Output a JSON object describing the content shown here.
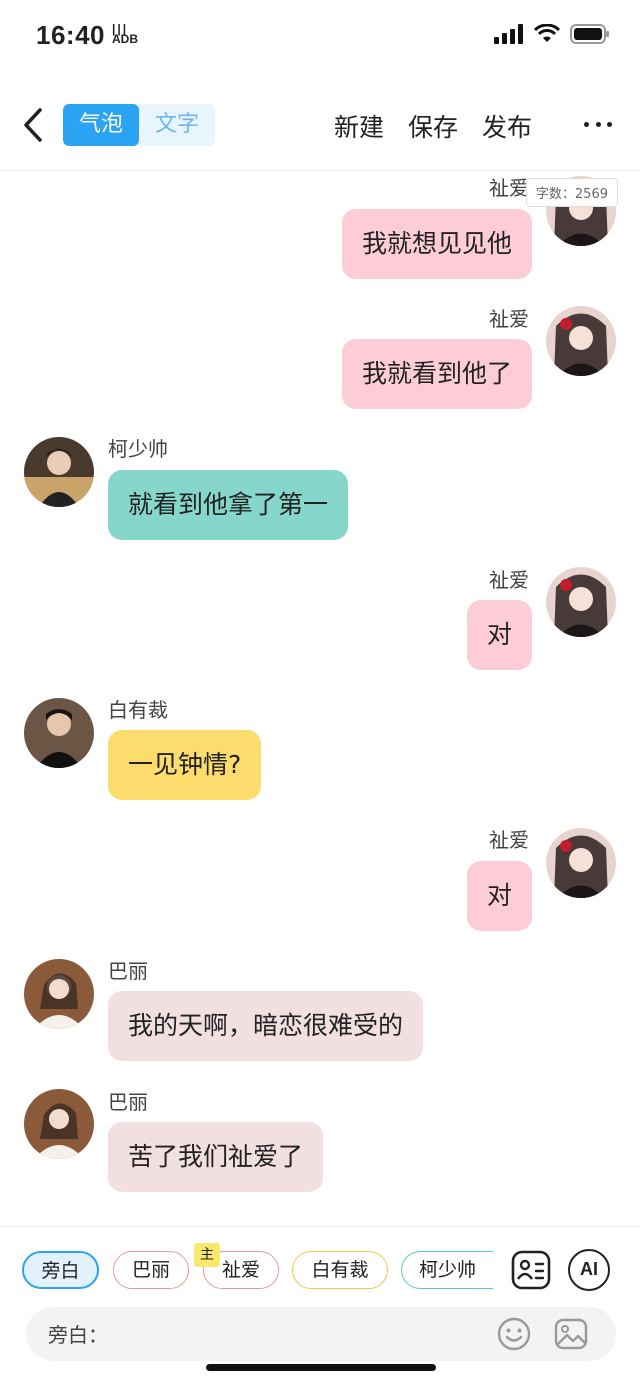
{
  "status": {
    "time": "16:40",
    "extra": "ADB"
  },
  "toolbar": {
    "seg_bubble": "气泡",
    "seg_text": "文字",
    "new_label": "新建",
    "save_label": "保存",
    "publish_label": "发布"
  },
  "word_count": "字数：2569",
  "messages": [
    {
      "speaker": "祉爱",
      "text": "我就想见见他",
      "side": "right"
    },
    {
      "speaker": "祉爱",
      "text": "我就看到他了",
      "side": "right"
    },
    {
      "speaker": "柯少帅",
      "text": "就看到他拿了第一",
      "side": "left"
    },
    {
      "speaker": "祉爱",
      "text": "对",
      "side": "right"
    },
    {
      "speaker": "白有裁",
      "text": "一见钟情?",
      "side": "left"
    },
    {
      "speaker": "祉爱",
      "text": "对",
      "side": "right"
    },
    {
      "speaker": "巴丽",
      "text": "我的天啊，暗恋很难受的",
      "side": "left"
    },
    {
      "speaker": "巴丽",
      "text": "苦了我们祉爱了",
      "side": "left"
    }
  ],
  "roles": [
    {
      "label": "旁白",
      "selected": true
    },
    {
      "label": "巴丽"
    },
    {
      "label": "祉爱",
      "tag": "主"
    },
    {
      "label": "白有裁"
    },
    {
      "label": "柯少帅"
    }
  ],
  "ai_label": "AI",
  "input": {
    "label": "旁白："
  },
  "colors": {
    "accent": "#2aa3f3",
    "bubble_pink": "#fcccd7",
    "bubble_teal": "#86d6cb",
    "bubble_yellow": "#fddc6e",
    "bubble_rose": "#f2dfe0"
  },
  "icons": [
    "back-arrow-icon",
    "more-icon",
    "contact-card-icon",
    "emoji-icon",
    "image-icon",
    "signal-icon",
    "wifi-icon",
    "battery-icon"
  ]
}
